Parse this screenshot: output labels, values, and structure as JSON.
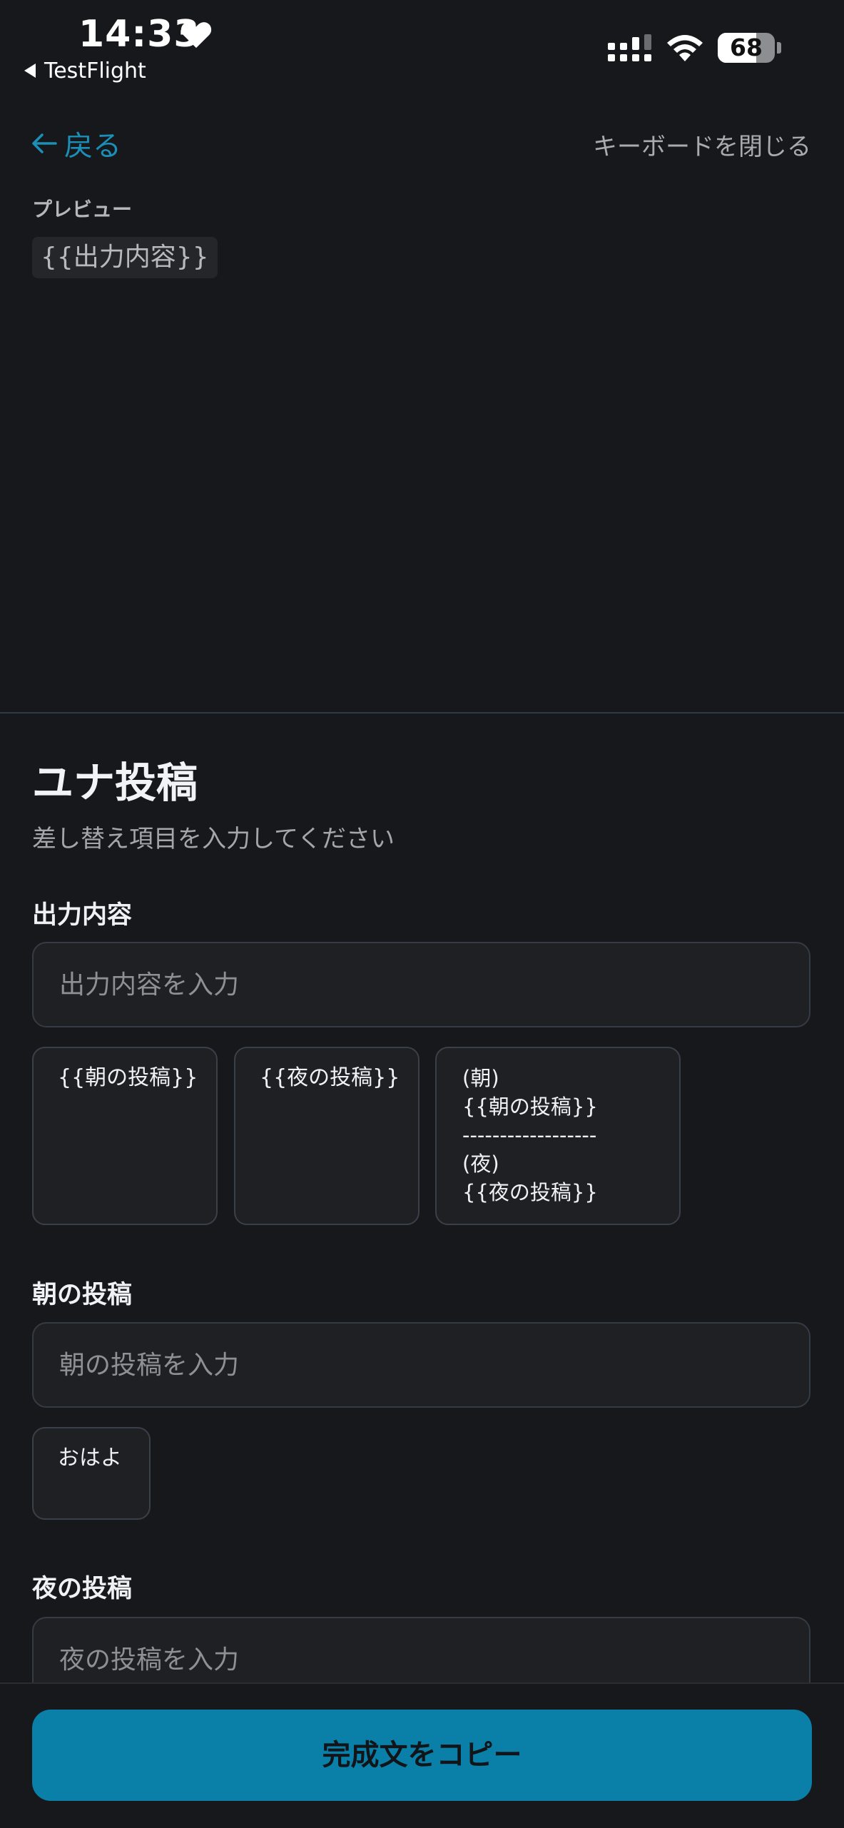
{
  "status_bar": {
    "time": "14:33",
    "back_app": "TestFlight",
    "battery": "68",
    "battery_level": 0.68
  },
  "nav": {
    "back_label": "戻る",
    "close_keyboard_label": "キーボードを閉じる"
  },
  "preview": {
    "label": "プレビュー",
    "content": "{{出力内容}}"
  },
  "form": {
    "title": "ユナ投稿",
    "subtitle": "差し替え項目を入力してください",
    "fields": [
      {
        "label": "出力内容",
        "placeholder": "出力内容を入力",
        "chips": [
          "{{朝の投稿}}",
          "{{夜の投稿}}",
          "(朝)\n{{朝の投稿}}\n------------------\n(夜)\n{{夜の投稿}}"
        ]
      },
      {
        "label": "朝の投稿",
        "placeholder": "朝の投稿を入力",
        "chips": [
          "おはよ"
        ]
      },
      {
        "label": "夜の投稿",
        "placeholder": "夜の投稿を入力",
        "chips": []
      }
    ]
  },
  "actions": {
    "copy_label": "完成文をコピー"
  },
  "colors": {
    "background": "#17181b",
    "accent": "#0a80a8",
    "link": "#1a8fb7"
  }
}
